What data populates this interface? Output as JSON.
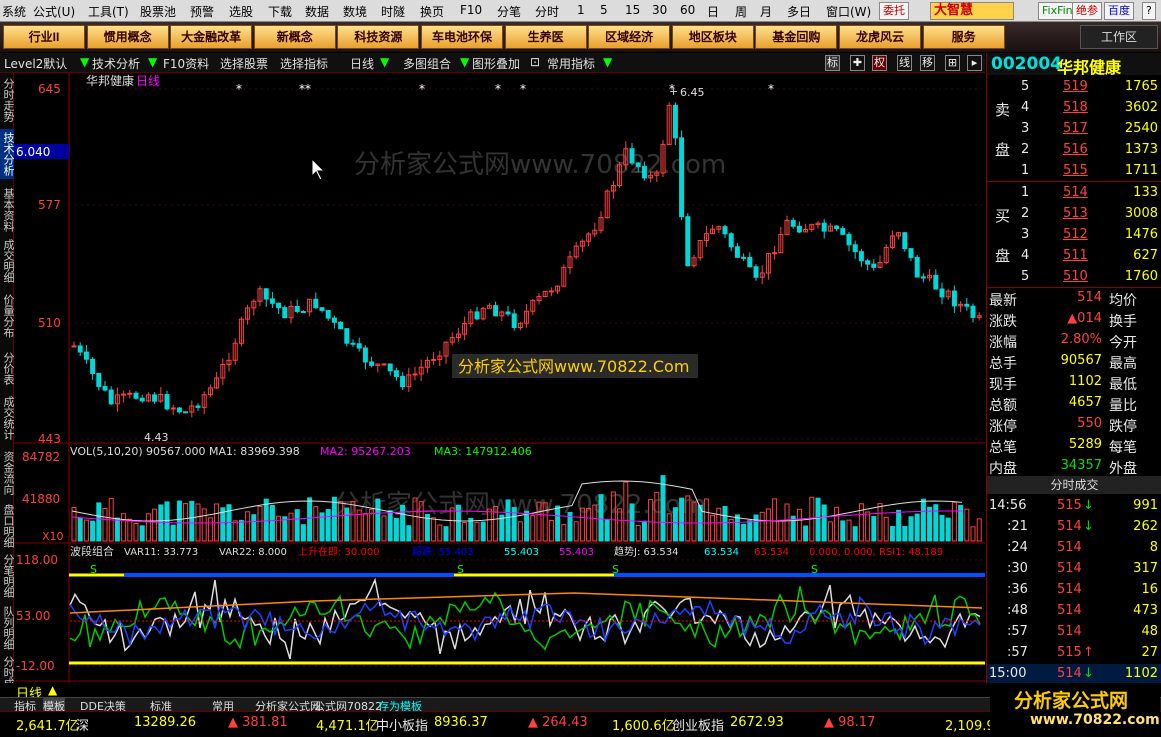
{
  "menu": {
    "items": [
      "系统",
      "公式(U)",
      "工具(T)",
      "股票池",
      "预警",
      "选股",
      "下载",
      "数据",
      "数境",
      "时隧",
      "换页",
      "F10",
      "分笔",
      "分时",
      "1",
      "5",
      "15",
      "30",
      "60",
      "日",
      "周",
      "月",
      "多日",
      "窗口(W)"
    ],
    "weituo": "委托",
    "brand": "大智慧",
    "fixfin": "FixFin",
    "juecan": "绝参",
    "baidu": "百度",
    "help": "?"
  },
  "toolbar": {
    "buttons": [
      "行业II",
      "惯用概念",
      "大金融改革",
      "新概念",
      "科技资源",
      "车电池环保",
      "生养医",
      "区域经济",
      "地区板块",
      "基金回购",
      "龙虎风云",
      "服务"
    ],
    "workzone": "工作区"
  },
  "toolbar2": {
    "level2": "Level2默认",
    "tech": "技术分析",
    "f10": "F10资料",
    "pick": "选择股票",
    "indicator": "选择指标",
    "period": "日线",
    "multi": "多图组合",
    "overlay": "图形叠加",
    "common": "常用指标",
    "mode_biao": "标",
    "mode_quan": "权",
    "mode_xian": "线",
    "mode_yi": "移"
  },
  "left_tabs": [
    "分时走势",
    "技术分析",
    "基本资料",
    "成交明细",
    "价量分布",
    "分价表",
    "成交统计",
    "资金流向",
    "盘口明细",
    "分笔明细",
    "队列明细",
    "分时成交"
  ],
  "chart": {
    "title": "华邦健康",
    "period_label": "日线",
    "watermark_top": "分析家公式网www.70822.com",
    "watermark_mid": "分析家公式网www.70822.Com",
    "watermark_vol": "分析家公式网www.70822.com",
    "price_ticks": [
      "645",
      "577",
      "510",
      "443"
    ],
    "current_price_tag": "6.040",
    "high_label": "6.45",
    "low_label": "4.43",
    "vol_label": "VOL(5,10,20)",
    "vol_value": "90567.000",
    "ma1": "MA1: 83969.398",
    "ma2": "MA2: 95267.203",
    "ma3": "MA3: 147912.406",
    "vol_ticks": [
      "84782",
      "41880"
    ],
    "vol_unit": "X10",
    "ind_label": "波段组合",
    "ind_values": [
      "VAR11: 33.773",
      "VAR22: 8.000",
      "上升在即: 30.000",
      "超跌: 55.403",
      "55.403",
      "55.403",
      "趋势J: 63.534",
      "63.534",
      "63.534",
      "0.000, 0.000, RSI1: 48.189"
    ],
    "ind_ticks": [
      "118.00",
      "53.00",
      "-12.00"
    ],
    "dates": [
      "2020/03",
      "04",
      "2020/04/30[四]",
      "06",
      "07",
      "08",
      "09"
    ]
  },
  "right": {
    "code": "002004",
    "name": "华邦健康",
    "sell_label1": "卖",
    "sell_label2": "盘",
    "buy_label1": "买",
    "buy_label2": "盘",
    "sell": [
      {
        "n": "5",
        "p": "519",
        "v": "1765"
      },
      {
        "n": "4",
        "p": "518",
        "v": "3602"
      },
      {
        "n": "3",
        "p": "517",
        "v": "2540"
      },
      {
        "n": "2",
        "p": "516",
        "v": "1373"
      },
      {
        "n": "1",
        "p": "515",
        "v": "1711"
      }
    ],
    "buy": [
      {
        "n": "1",
        "p": "514",
        "v": "133"
      },
      {
        "n": "2",
        "p": "513",
        "v": "3008"
      },
      {
        "n": "3",
        "p": "512",
        "v": "1476"
      },
      {
        "n": "4",
        "p": "511",
        "v": "627"
      },
      {
        "n": "5",
        "p": "510",
        "v": "1760"
      }
    ],
    "stats": [
      {
        "k": "最新",
        "v": "514",
        "k2": "均价",
        "v2": ""
      },
      {
        "k": "涨跌",
        "v": "▲014",
        "k2": "换手",
        "v2": ""
      },
      {
        "k": "涨幅",
        "v": "2.80%",
        "k2": "今开",
        "v2": ""
      },
      {
        "k": "总手",
        "v": "90567",
        "k2": "最高",
        "v2": ""
      },
      {
        "k": "现手",
        "v": "1102",
        "k2": "最低",
        "v2": ""
      },
      {
        "k": "总额",
        "v": "4657",
        "k2": "量比",
        "v2": ""
      },
      {
        "k": "涨停",
        "v": "550",
        "k2": "跌停",
        "v2": ""
      },
      {
        "k": "总笔",
        "v": "5289",
        "k2": "每笔",
        "v2": ""
      }
    ],
    "neipan_label": "内盘",
    "neipan": "34357",
    "waipan_label": "外盘",
    "fenshi_title": "分时成交",
    "trades": [
      {
        "t": "14:56",
        "p": "515",
        "d": "↓",
        "v": "991"
      },
      {
        "t": ":21",
        "p": "514",
        "d": "↓",
        "v": "262"
      },
      {
        "t": ":24",
        "p": "514",
        "d": "",
        "v": "8"
      },
      {
        "t": ":30",
        "p": "514",
        "d": "",
        "v": "317"
      },
      {
        "t": ":36",
        "p": "514",
        "d": "",
        "v": "16"
      },
      {
        "t": ":48",
        "p": "514",
        "d": "",
        "v": "473"
      },
      {
        "t": ":57",
        "p": "514",
        "d": "",
        "v": "48"
      },
      {
        "t": ":57",
        "p": "515",
        "d": "↑",
        "v": "27"
      },
      {
        "t": "15:00",
        "p": "514",
        "d": "↓",
        "v": "1102"
      }
    ]
  },
  "bottom": {
    "period": "日线",
    "tabs": [
      "指标",
      "模板",
      "DDE决策",
      "标准",
      "常用",
      "分析家公式网",
      "公式网70822",
      "存为模板"
    ],
    "logo": "分析家公式网",
    "logo_url": "www.70822.com"
  },
  "status": [
    {
      "k": "2,641.7亿",
      "n": "深",
      "v": "13289.26",
      "c": "▲ 381.81"
    },
    {
      "k": "4,471.1亿",
      "n": "中小板指",
      "v": "8936.37",
      "c": "▲ 264.43"
    },
    {
      "k": "1,600.6亿",
      "n": "创业板指",
      "v": "2672.93",
      "c": "▲ 98.17"
    },
    {
      "k": "2,109.9亿",
      "n": "",
      "v": "",
      "c": ""
    }
  ]
}
